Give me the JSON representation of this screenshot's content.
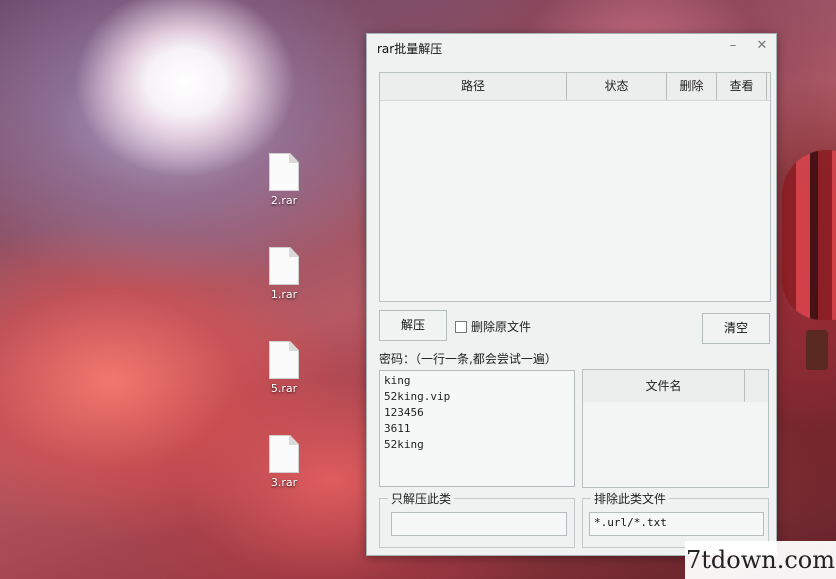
{
  "desktop": {
    "icons": [
      {
        "label": "2.rar"
      },
      {
        "label": "1.rar"
      },
      {
        "label": "5.rar"
      },
      {
        "label": "3.rar"
      }
    ]
  },
  "window": {
    "title": "rar批量解压",
    "minimize_glyph": "–",
    "close_glyph": "✕"
  },
  "table": {
    "columns": [
      "路径",
      "状态",
      "删除",
      "查看"
    ],
    "rows": []
  },
  "buttons": {
    "extract": "解压",
    "clear": "清空"
  },
  "delete_original": {
    "label": "删除原文件",
    "checked": false
  },
  "password": {
    "label": "密码：（一行一条,都会尝试一遍）",
    "lines": [
      "king",
      "52king.vip",
      "123456",
      "3611",
      "52king"
    ]
  },
  "filename_table": {
    "column": "文件名",
    "rows": []
  },
  "only_extract": {
    "legend": "只解压此类",
    "value": ""
  },
  "exclude": {
    "legend": "排除此类文件",
    "value": "*.url/*.txt"
  },
  "watermark": "7tdown.com",
  "colors": {
    "window_bg": "#f0f2f1",
    "border": "#b5bcbe"
  }
}
